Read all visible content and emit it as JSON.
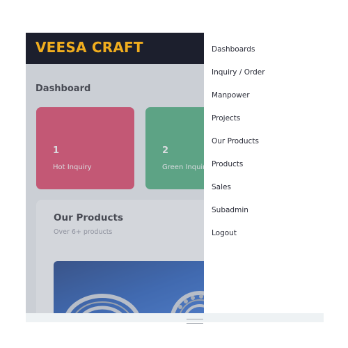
{
  "app": {
    "brand": "VEESA CRAFT"
  },
  "dashboard": {
    "title": "Dashboard",
    "cards": [
      {
        "value": "1",
        "label": "Hot Inquiry",
        "color": "#dc355b"
      },
      {
        "value": "2",
        "label": "Green Inquiry",
        "color": "#3fa873"
      }
    ]
  },
  "products_panel": {
    "title": "Our Products",
    "subtitle": "Over 6+ products"
  },
  "menu": {
    "items": [
      {
        "label": "Dashboards"
      },
      {
        "label": "Inquiry / Order"
      },
      {
        "label": "Manpower"
      },
      {
        "label": "Projects"
      },
      {
        "label": "Our Products"
      },
      {
        "label": "Products"
      },
      {
        "label": "Sales"
      },
      {
        "label": "Subadmin"
      },
      {
        "label": "Logout"
      }
    ]
  },
  "colors": {
    "brand": "#f0ad1e",
    "topbar": "#1c1f2d",
    "hot": "#dc355b",
    "green": "#3fa873"
  }
}
